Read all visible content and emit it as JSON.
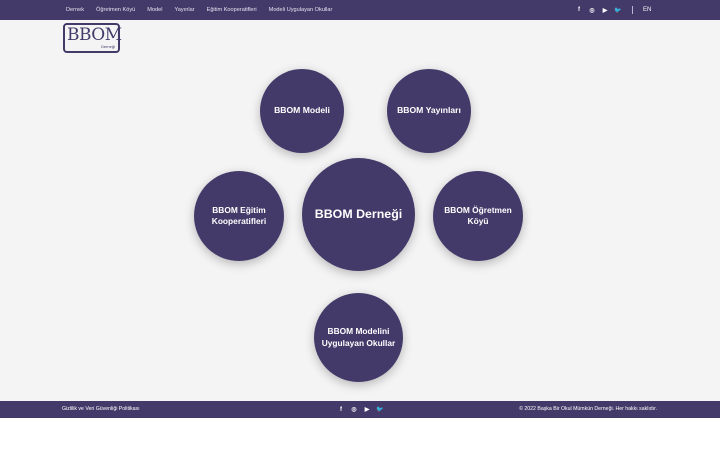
{
  "nav": {
    "items": [
      "Dernek",
      "Öğretmen Köyü",
      "Model",
      "Yayınlar",
      "Eğitim Kooperatifleri",
      "Modeli Uygulayan Okullar"
    ]
  },
  "social_icons": {
    "facebook": "f",
    "instagram": "◎",
    "youtube": "▶",
    "twitter": "🐦"
  },
  "lang": "EN",
  "logo": {
    "main": "BBOM",
    "sub": "Derneği"
  },
  "circles": {
    "modeli": "BBOM Modeli",
    "yayinlari": "BBOM Yayınları",
    "dernegi": "BBOM Derneği",
    "egitim": "BBOM Eğitim Kooperatifleri",
    "koyu": "BBOM Öğretmen Köyü",
    "okullar": "BBOM Modelini Uygulayan Okullar"
  },
  "footer": {
    "privacy": "Gizlilik ve Veri Güvenliği Politikası",
    "copyright": "© 2022 Başka Bir Okul Mümkün Derneği. Her hakkı saklıdır."
  },
  "colors": {
    "brand": "#433a69",
    "background": "#f4f4f5"
  }
}
